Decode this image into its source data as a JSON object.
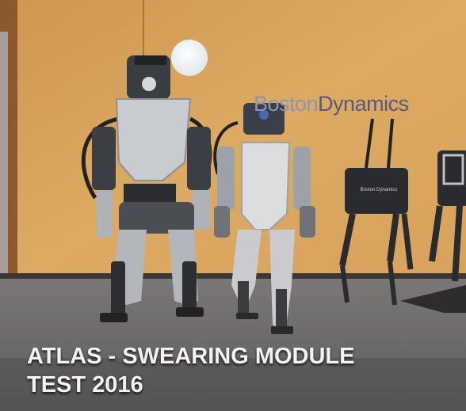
{
  "wall_logo": {
    "part1": "Boston",
    "part2": "Dynamics"
  },
  "robot_label": "Boston Dynamics",
  "caption": {
    "line1": "ATLAS - SWEARING MODULE",
    "line2": "TEST 2016"
  },
  "colors": {
    "wall": "#d9a35a",
    "floor": "#6f6d6c",
    "caption": "#f2f2f2",
    "logo": "#6a7190"
  }
}
